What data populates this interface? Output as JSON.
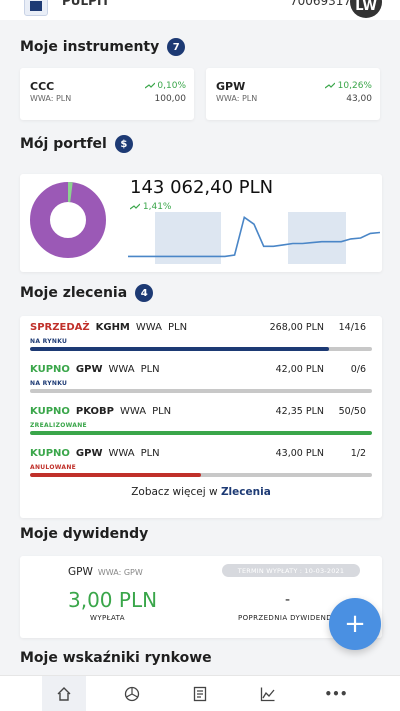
{
  "header": {
    "app_title": "PULPIT",
    "account_number": "70069317",
    "avatar_initials": "LW"
  },
  "instruments": {
    "title": "Moje instrumenty",
    "count": "7",
    "items": [
      {
        "name": "CCC",
        "market": "WWA: PLN",
        "change": "0,10%",
        "price": "100,00"
      },
      {
        "name": "GPW",
        "market": "WWA: PLN",
        "change": "10,26%",
        "price": "43,00"
      }
    ]
  },
  "portfolio": {
    "title": "Mój portfel",
    "badge_icon": "dollar-icon",
    "value": "143 062,40 PLN",
    "change": "1,41%",
    "donut_colors": [
      "#9b59b6",
      "#8cd38f"
    ],
    "donut_share_green": 0.02,
    "sparkline": [
      0.1,
      0.1,
      0.1,
      0.1,
      0.1,
      0.1,
      0.1,
      0.1,
      0.1,
      0.1,
      0.1,
      0.13,
      0.95,
      0.8,
      0.32,
      0.32,
      0.35,
      0.38,
      0.38,
      0.4,
      0.42,
      0.42,
      0.42,
      0.48,
      0.5,
      0.6,
      0.62
    ]
  },
  "orders": {
    "title": "Moje zlecenia",
    "count": "4",
    "items": [
      {
        "side": "SPRZEDAŻ",
        "side_color": "#c0302a",
        "instrument": "KGHM",
        "market": "WWA",
        "currency": "PLN",
        "status": "NA RYNKU",
        "status_color": "#1d3a74",
        "price": "268,00 PLN",
        "qty": "14/16",
        "fill": 0.875,
        "fill_color": "#1d3a74"
      },
      {
        "side": "KUPNO",
        "side_color": "#3aa64a",
        "instrument": "GPW",
        "market": "WWA",
        "currency": "PLN",
        "status": "NA RYNKU",
        "status_color": "#1d3a74",
        "price": "42,00 PLN",
        "qty": "0/6",
        "fill": 0.0,
        "fill_color": "#1d3a74"
      },
      {
        "side": "KUPNO",
        "side_color": "#3aa64a",
        "instrument": "PKOBP",
        "market": "WWA",
        "currency": "PLN",
        "status": "ZREALIZOWANE",
        "status_color": "#3aa64a",
        "price": "42,35 PLN",
        "qty": "50/50",
        "fill": 1.0,
        "fill_color": "#3aa64a"
      },
      {
        "side": "KUPNO",
        "side_color": "#3aa64a",
        "instrument": "GPW",
        "market": "WWA",
        "currency": "PLN",
        "status": "ANULOWANE",
        "status_color": "#c0302a",
        "price": "43,00 PLN",
        "qty": "1/2",
        "fill": 0.5,
        "fill_color": "#c0302a"
      }
    ],
    "see_more_prefix": "Zobacz więcej w ",
    "see_more_link": "Zlecenia"
  },
  "dividends": {
    "title": "Moje dywidendy",
    "instrument": "GPW",
    "market": "WWA: GPW",
    "term_label": "TERMIN WYPŁATY : 10-03-2021",
    "amount": "3,00 PLN",
    "amount_label": "WYPŁATA",
    "prev_value": "-",
    "prev_label": "POPRZEDNIA DYWIDENDA"
  },
  "indicators": {
    "title": "Moje wskaźniki rynkowe"
  },
  "fab": {
    "label": "+"
  },
  "bottom_nav": [
    {
      "icon": "home-icon"
    },
    {
      "icon": "pie-chart-icon"
    },
    {
      "icon": "document-icon"
    },
    {
      "icon": "chart-icon"
    },
    {
      "icon": "more-icon",
      "label": "•••"
    }
  ]
}
